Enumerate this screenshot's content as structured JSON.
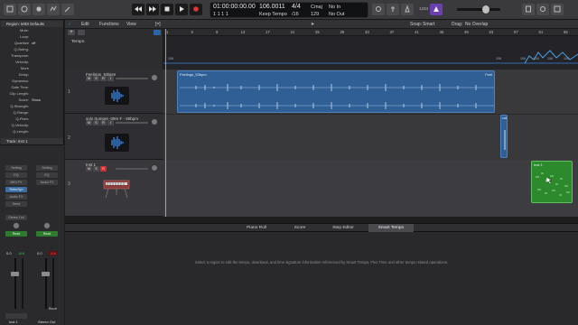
{
  "control_bar": {
    "position_time": "01:00:00:00.00",
    "position_bars": "1    1    1    1",
    "tempo": "106.0011",
    "tempo_mode": "Keep Tempo",
    "time_signature": "4/4",
    "division": "/16",
    "key": "Cmaj",
    "key_alt": "129",
    "midi_in": "No In",
    "midi_out": "No Out",
    "cpu_label": "1234"
  },
  "inspector": {
    "region_header": "Region: MIDI Defaults",
    "params": [
      {
        "label": "Mute:",
        "value": ""
      },
      {
        "label": "Loop:",
        "value": ""
      },
      {
        "label": "Quantize",
        "value": "off"
      },
      {
        "label": "Q-Swing:",
        "value": ""
      },
      {
        "label": "Transpose:",
        "value": ""
      },
      {
        "label": "Velocity:",
        "value": ""
      },
      {
        "label": "More",
        "value": ""
      },
      {
        "label": "Delay:",
        "value": ""
      },
      {
        "label": "Dynamics:",
        "value": ""
      },
      {
        "label": "Gate Time:",
        "value": ""
      },
      {
        "label": "Clip Length:",
        "value": ""
      },
      {
        "label": "Score:",
        "value": "Show"
      },
      {
        "label": "Q-Strength:",
        "value": ""
      },
      {
        "label": "Q-Range:",
        "value": ""
      },
      {
        "label": "Q-Flam:",
        "value": ""
      },
      {
        "label": "Q-Velocity:",
        "value": ""
      },
      {
        "label": "Q-Length:",
        "value": ""
      }
    ],
    "track_header": "Track: Inst 1",
    "strip_left": {
      "setting": "Setting",
      "eq": "EQ",
      "midi_fx": "MIDI FX",
      "instrument": "RetroSyn",
      "audio_fx": "Audio FX",
      "send": "Send",
      "output": "Stereo Out",
      "automation": "Read",
      "vol": "0.0",
      "pan": "-8.6",
      "name": "Inst 1"
    },
    "strip_right": {
      "setting": "Setting",
      "eq": "EQ",
      "audio_fx": "Audio FX",
      "automation": "Read",
      "vol": "0.0",
      "pan": "-8.6",
      "bounce": "Bnce",
      "name": "Stereo Out"
    }
  },
  "tracks_toolbar": {
    "edit": "Edit",
    "functions": "Functions",
    "view": "View",
    "snap_label": "Snap:",
    "snap_value": "Smart",
    "drag_label": "Drag:",
    "drag_value": "No Overlap"
  },
  "ruler": {
    "bars": [
      "1",
      "5",
      "9",
      "13",
      "17",
      "21",
      "25",
      "29",
      "33",
      "37",
      "41",
      "45",
      "49",
      "53",
      "57",
      "61",
      "65"
    ]
  },
  "tempo_track": {
    "label": "Tempo",
    "values": [
      "106",
      "106",
      "106",
      "105",
      "106",
      "105"
    ]
  },
  "tracks": [
    {
      "number": "1",
      "name": "Feelings_53bpm",
      "region": "Feelings_53bpm",
      "region_end_label": "Feel"
    },
    {
      "number": "2",
      "name": "solo trumpet -09m F - 90bpm",
      "region": "soli"
    },
    {
      "number": "3",
      "name": "Inst 1",
      "region": "Inst 1"
    }
  ],
  "editor": {
    "tabs": [
      "Piano Roll",
      "Score",
      "Step Editor",
      "Smart Tempo"
    ],
    "active_tab": "Smart Tempo",
    "message": "Select a region to edit the tempo, downbeat, and time signature information referenced by Smart Tempo, Flex Time and other tempo related operations."
  },
  "colors": {
    "audio_region": "#2f5f95",
    "midi_region": "#2c8a2c",
    "record": "#e03535",
    "accent": "#4aa0e6"
  }
}
